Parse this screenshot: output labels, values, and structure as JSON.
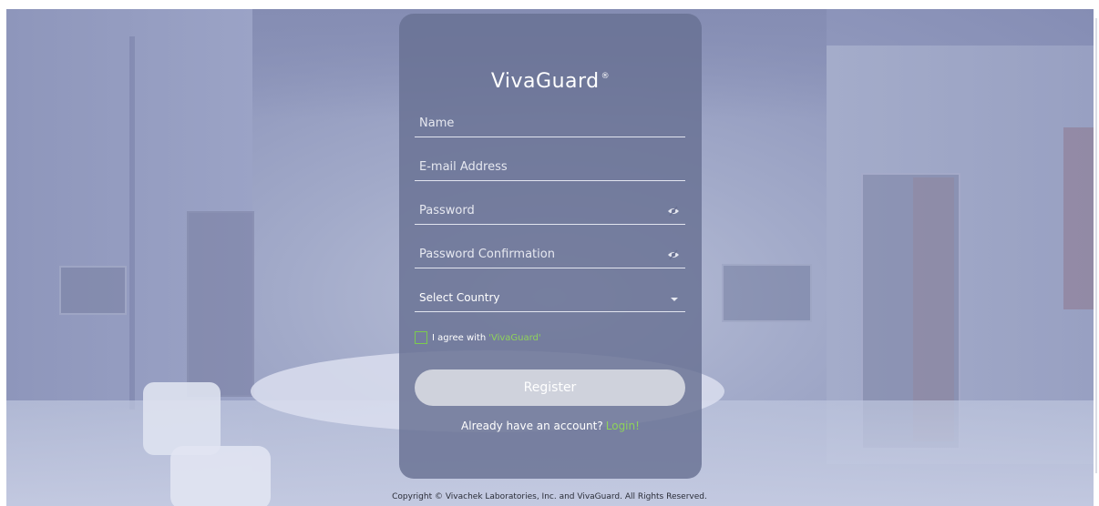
{
  "brand": {
    "logo": "VivaGuard",
    "reg_mark": "®"
  },
  "form": {
    "name_placeholder": "Name",
    "email_placeholder": "E-mail Address",
    "password_placeholder": "Password",
    "password_confirm_placeholder": "Password Confirmation",
    "country_select": "Select Country",
    "agree_text": "I agree with",
    "agree_link": "'VivaGuard'",
    "register_label": "Register",
    "account_question": "Already have an account?",
    "login_link": "Login!"
  },
  "footer": {
    "copyright": "Copyright © Vivachek Laboratories, Inc. and VivaGuard. All Rights Reserved."
  },
  "icons": {
    "password_toggle": "eye-off-icon",
    "dropdown": "chevron-down-icon"
  },
  "colors": {
    "accent_green": "#8fd35a",
    "card_bg": "#687092",
    "button_bg": "#cfd2dc"
  }
}
